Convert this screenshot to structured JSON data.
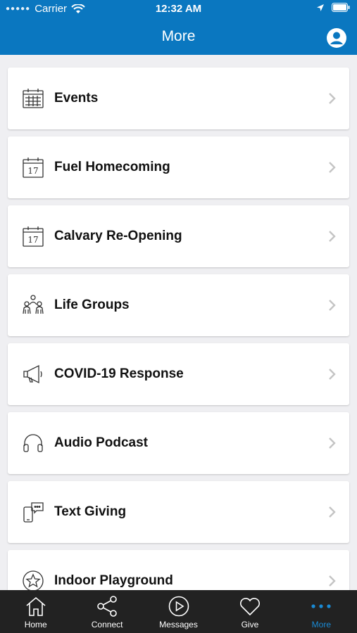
{
  "status": {
    "carrier": "Carrier",
    "time": "12:32 AM"
  },
  "header": {
    "title": "More"
  },
  "items": [
    {
      "label": "Events",
      "icon": "calendar-grid-icon"
    },
    {
      "label": "Fuel Homecoming",
      "icon": "calendar-day-icon",
      "day": "17"
    },
    {
      "label": "Calvary Re-Opening",
      "icon": "calendar-day-icon",
      "day": "17"
    },
    {
      "label": "Life Groups",
      "icon": "people-group-icon"
    },
    {
      "label": "COVID-19 Response",
      "icon": "megaphone-icon"
    },
    {
      "label": "Audio Podcast",
      "icon": "headphones-icon"
    },
    {
      "label": "Text Giving",
      "icon": "phone-message-icon"
    },
    {
      "label": "Indoor Playground",
      "icon": "star-circle-icon"
    }
  ],
  "tabs": [
    {
      "label": "Home",
      "icon": "home-icon"
    },
    {
      "label": "Connect",
      "icon": "share-icon"
    },
    {
      "label": "Messages",
      "icon": "play-circle-icon"
    },
    {
      "label": "Give",
      "icon": "heart-icon"
    },
    {
      "label": "More",
      "icon": "more-dots-icon"
    }
  ],
  "colors": {
    "header": "#0a77c0",
    "tabbar": "#222222",
    "active_tab": "#1a8ad4"
  }
}
